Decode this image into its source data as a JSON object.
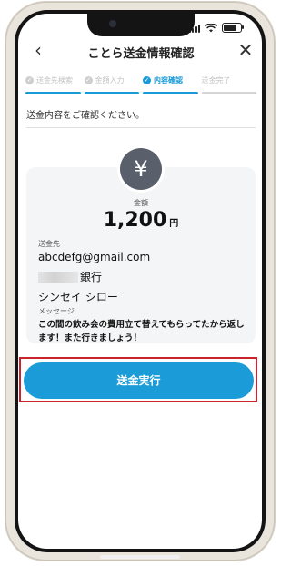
{
  "navbar": {
    "title": "ことら送金情報確認",
    "back_icon": "chevron-left-icon",
    "close_icon": "close-icon"
  },
  "stepper": {
    "steps": [
      {
        "label": "送金先検索",
        "state": "done"
      },
      {
        "label": "金額入力",
        "state": "done"
      },
      {
        "label": "内容確認",
        "state": "active"
      },
      {
        "label": "送金完了",
        "state": "pending"
      }
    ]
  },
  "instruction": "送金内容をご確認ください。",
  "summary": {
    "icon": "yen-icon",
    "icon_glyph": "¥",
    "amount_label": "金額",
    "amount_value": "1,200",
    "amount_unit": "円",
    "recipient_label": "送金先",
    "recipient_email": "abcdefg@gmail.com",
    "bank_suffix": "銀行",
    "account_name": "シンセイ シロー",
    "message_label": "メッセージ",
    "message_text": "この間の飲み会の費用立て替えてもらってたから返します！また行きましょう！"
  },
  "actions": {
    "submit_label": "送金実行"
  },
  "colors": {
    "accent": "#1b9cd8",
    "highlight": "#c9232d"
  }
}
